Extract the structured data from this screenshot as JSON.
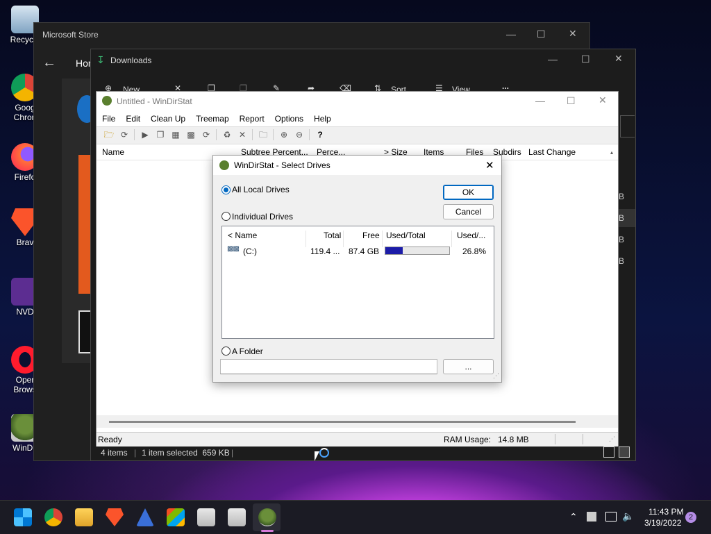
{
  "desktop": {
    "icons": [
      {
        "label": "Recycle"
      },
      {
        "label": "Goog Chron"
      },
      {
        "label": "Firefo"
      },
      {
        "label": "Brav"
      },
      {
        "label": "NVD"
      },
      {
        "label": "Oper Brows"
      },
      {
        "label": "WinDir"
      }
    ]
  },
  "store_window": {
    "title": "Microsoft Store",
    "tab": "Hom"
  },
  "downloads_window": {
    "title": "Downloads",
    "toolbar": {
      "new": "New",
      "sort": "Sort",
      "view": "View",
      "more": "..."
    },
    "status": {
      "items": "4 items",
      "selected": "1 item selected  659 KB"
    },
    "right_items": [
      "B",
      "B",
      "B",
      "B"
    ]
  },
  "windirstat": {
    "title": "Untitled - WinDirStat",
    "menu": [
      "File",
      "Edit",
      "Clean Up",
      "Treemap",
      "Report",
      "Options",
      "Help"
    ],
    "columns": [
      "Name",
      "Subtree Percent...",
      "Perce...",
      "> Size",
      "Items",
      "Files",
      "Subdirs",
      "Last Change"
    ],
    "status_ready": "Ready",
    "ram_label": "RAM Usage:",
    "ram_value": "14.8 MB"
  },
  "dialog": {
    "title": "WinDirStat - Select Drives",
    "all_local_drives": "All Local Drives",
    "individual_drives": "Individual Drives",
    "a_folder": "A Folder",
    "ok": "OK",
    "cancel": "Cancel",
    "browse": "...",
    "folder_value": "",
    "list_headers": [
      "< Name",
      "Total",
      "Free",
      "Used/Total",
      "Used/..."
    ],
    "drives": [
      {
        "name": "(C:)",
        "total": "119.4 ...",
        "free": "87.4 GB",
        "used_fraction": 0.268,
        "used_pct": "26.8%"
      }
    ]
  },
  "taskbar": {
    "time": "11:43 PM",
    "date": "3/19/2022",
    "notification_count": "2"
  }
}
